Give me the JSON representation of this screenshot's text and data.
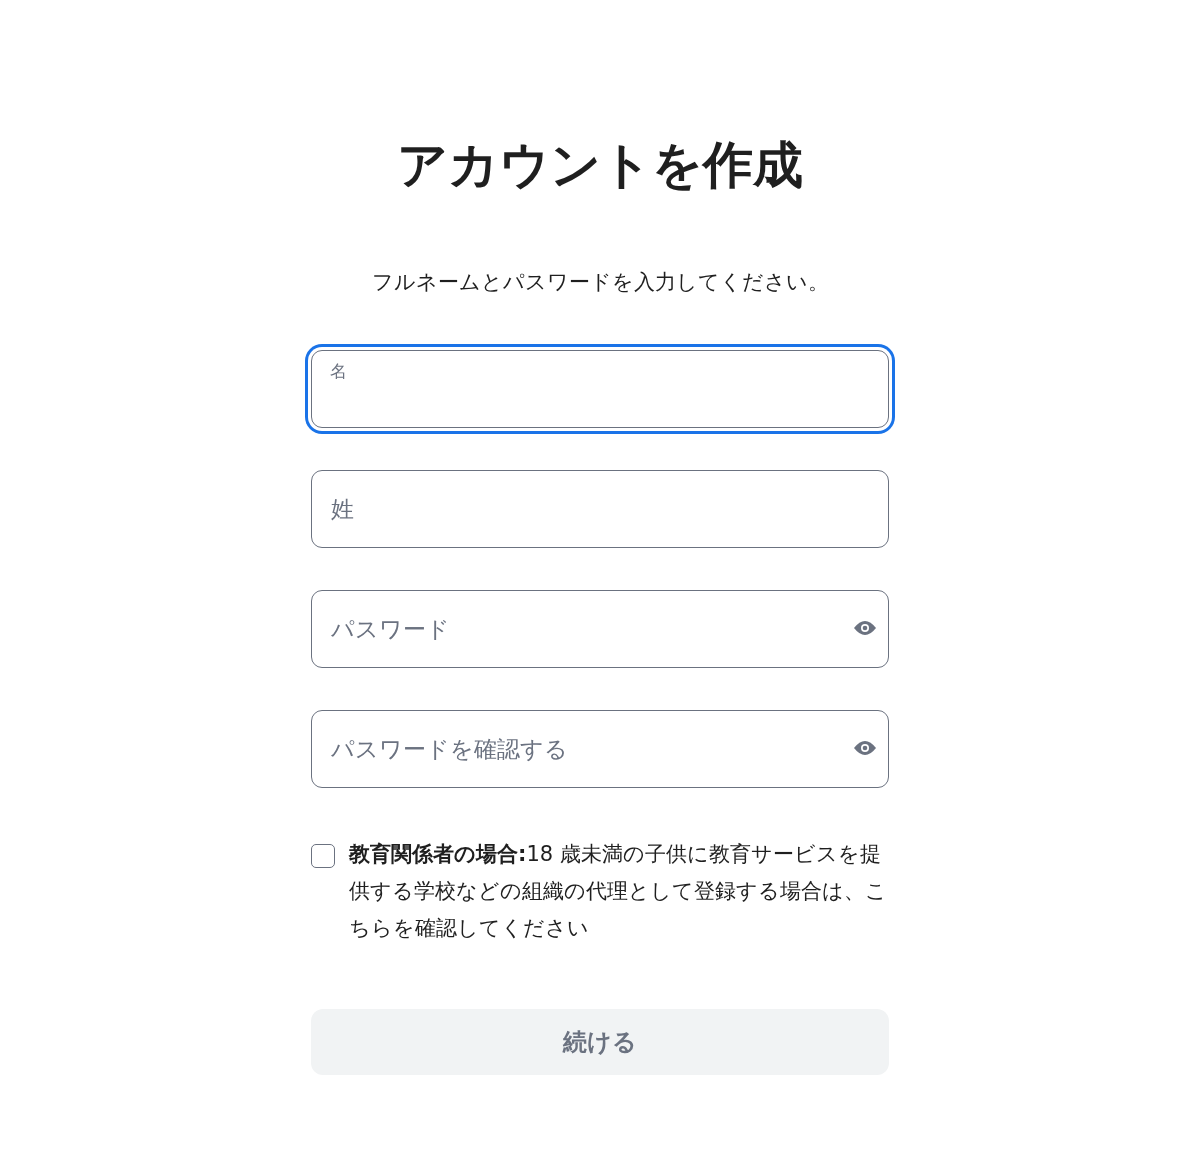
{
  "title": "アカウントを作成",
  "subtitle": "フルネームとパスワードを入力してください。",
  "fields": [
    {
      "placeholder": "名",
      "kind": "text",
      "focused": true
    },
    {
      "placeholder": "姓",
      "kind": "text",
      "focused": false
    },
    {
      "placeholder": "パスワード",
      "kind": "password",
      "focused": false
    },
    {
      "placeholder": "パスワードを確認する",
      "kind": "password",
      "focused": false
    }
  ],
  "consent": {
    "checked": false,
    "text": "**教育関係者の場合:**18 歳未満の子供に教育サービスを提供する学校などの組織の代理として登録する場合は、こちらを確認してください"
  },
  "continue_button": {
    "label": "続ける",
    "disabled": true
  }
}
